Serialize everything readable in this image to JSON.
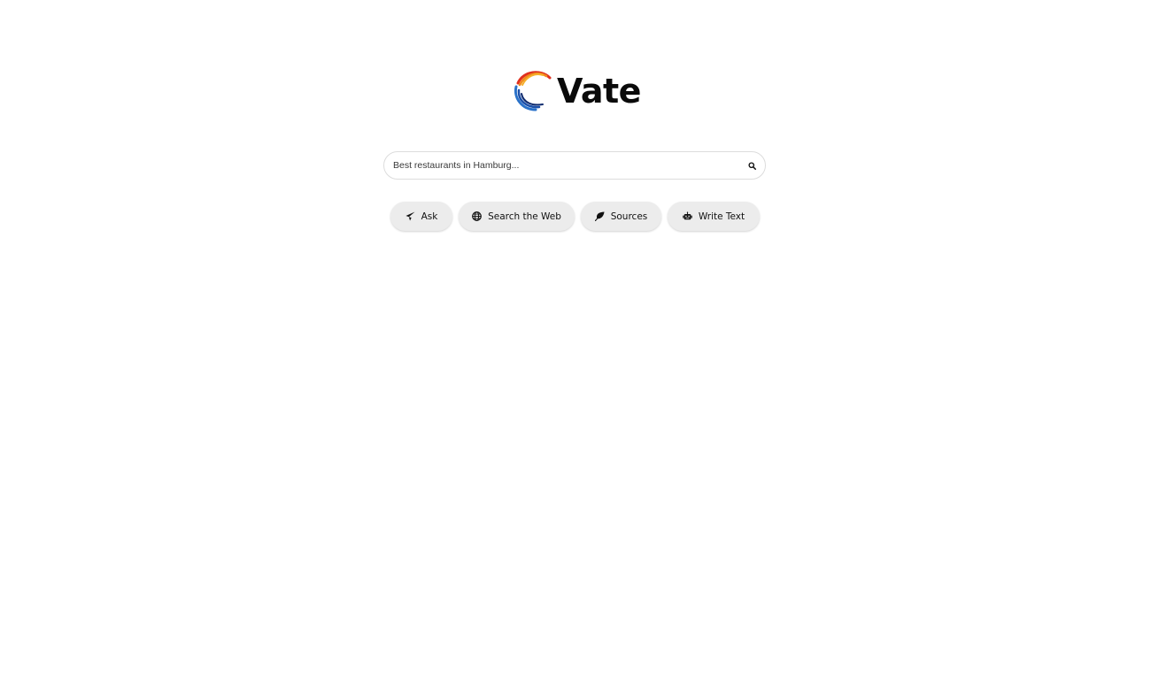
{
  "brand": {
    "name": "Vate",
    "logo_icon": "swirl-logo-icon"
  },
  "search": {
    "placeholder": "Best restaurants in Hamburg...",
    "value": "",
    "button_icon": "search-icon"
  },
  "actions": [
    {
      "label": "Ask",
      "icon": "paper-plane-icon"
    },
    {
      "label": "Search the Web",
      "icon": "globe-icon"
    },
    {
      "label": "Sources",
      "icon": "leaf-icon"
    },
    {
      "label": "Write Text",
      "icon": "robot-icon"
    }
  ],
  "colors": {
    "button_bg": "#ececec",
    "logo_orange": "#f08a1c",
    "logo_red": "#e0301e",
    "logo_blue": "#1b4fa8",
    "logo_navy": "#0e2a6e"
  }
}
